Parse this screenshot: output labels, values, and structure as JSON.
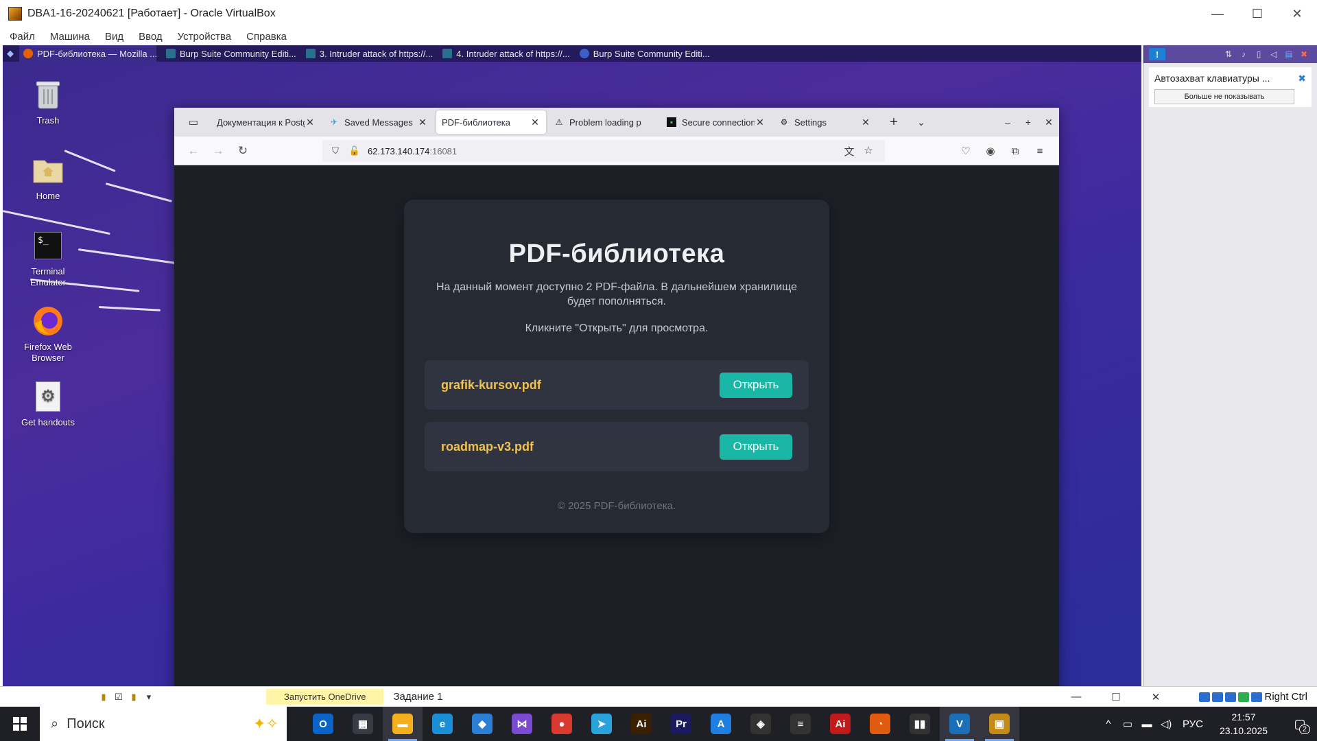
{
  "vbox": {
    "title": "DBA1-16-20240621 [Работает] - Oracle VirtualBox",
    "menu": [
      "Файл",
      "Машина",
      "Вид",
      "Ввод",
      "Устройства",
      "Справка"
    ],
    "minimize": "—",
    "maximize": "☐",
    "close": "✕"
  },
  "guest_taskbar": {
    "items": [
      {
        "label": "PDF-библиотека — Mozilla ...",
        "color": "#e66000"
      },
      {
        "label": "Burp Suite Community Editi...",
        "color": "#2a6f8e"
      },
      {
        "label": "3. Intruder attack of https://...",
        "color": "#2a6f8e"
      },
      {
        "label": "4. Intruder attack of https://...",
        "color": "#2a6f8e"
      },
      {
        "label": "Burp Suite Community Editi...",
        "color": "#3a5fc8"
      }
    ]
  },
  "desktop_icons": [
    {
      "label": "Trash",
      "icon": "trash-icon"
    },
    {
      "label": "Home",
      "icon": "home-folder-icon"
    },
    {
      "label": "Terminal Emulator",
      "icon": "terminal-icon",
      "glyph": "$_"
    },
    {
      "label": "Firefox Web Browser",
      "icon": "firefox-icon"
    },
    {
      "label": "Get handouts",
      "icon": "gear-icon",
      "glyph": "⚙"
    }
  ],
  "firefox": {
    "tabs": [
      {
        "label": "Документация к Postg",
        "icon": "",
        "active": false
      },
      {
        "label": "Saved Messages",
        "icon": "✈",
        "active": false
      },
      {
        "label": "PDF-библиотека",
        "icon": "",
        "active": true
      },
      {
        "label": "Problem loading p",
        "icon": "⚠",
        "active": false
      },
      {
        "label": "Secure connection",
        "icon": "▪",
        "active": false
      },
      {
        "label": "Settings",
        "icon": "⚙",
        "active": false
      }
    ],
    "tab_close": "✕",
    "new_tab": "+",
    "list_all_tabs": "⌄",
    "window_controls": [
      "–",
      "+",
      "✕"
    ],
    "url_host": "62.173.140.174",
    "url_port": ":16081"
  },
  "page": {
    "title": "PDF-библиотека",
    "description": "На данный момент доступно 2 PDF-файла. В дальнейшем хранилище будет пополняться.",
    "hint": "Кликните \"Открыть\" для просмотра.",
    "files": [
      {
        "name": "grafik-kursov.pdf",
        "button": "Открыть"
      },
      {
        "name": "roadmap-v3.pdf",
        "button": "Открыть"
      }
    ],
    "footer": "© 2025 PDF-библиотека."
  },
  "side_panel": {
    "badge": "!",
    "notice_title": "Автозахват клавиатуры ...",
    "notice_button": "Больше не показывать"
  },
  "vbox_status": {
    "onedrive": "Запустить OneDrive",
    "task": "Задание 1",
    "host_key": "Right Ctrl"
  },
  "win_taskbar": {
    "search_placeholder": "Поиск",
    "apps": [
      {
        "name": "outlook-icon",
        "glyph": "O",
        "color": "#0a64c8"
      },
      {
        "name": "store-icon",
        "glyph": "▦",
        "color": "#3a3a44"
      },
      {
        "name": "file-explorer-icon",
        "glyph": "▬",
        "color": "#f2b01e",
        "active": true
      },
      {
        "name": "edge-icon",
        "glyph": "e",
        "color": "#1b8fd6"
      },
      {
        "name": "paint-icon",
        "glyph": "◆",
        "color": "#2a7fd4"
      },
      {
        "name": "visual-studio-icon",
        "glyph": "⋈",
        "color": "#7a4bd1"
      },
      {
        "name": "chrome-icon",
        "glyph": "●",
        "color": "#d93a2f"
      },
      {
        "name": "telegram-icon",
        "glyph": "➤",
        "color": "#2aa3dd"
      },
      {
        "name": "illustrator-icon",
        "glyph": "Ai",
        "color": "#3a1f00"
      },
      {
        "name": "premiere-icon",
        "glyph": "Pr",
        "color": "#1a1a5e"
      },
      {
        "name": "app-store-icon",
        "glyph": "A",
        "color": "#1e7fe0"
      },
      {
        "name": "unity-icon",
        "glyph": "◈",
        "color": "#333"
      },
      {
        "name": "app-bars-icon",
        "glyph": "≡",
        "color": "#333"
      },
      {
        "name": "acrobat-icon",
        "glyph": "Ai",
        "color": "#c01a1a"
      },
      {
        "name": "power-icon",
        "glyph": "◔",
        "color": "#e05a10"
      },
      {
        "name": "twitch-icon",
        "glyph": "▮▮",
        "color": "#333"
      },
      {
        "name": "virtualbox-vm-icon",
        "glyph": "V",
        "color": "#1b6fb8",
        "active": true
      },
      {
        "name": "virtualbox-icon",
        "glyph": "▣",
        "color": "#c48a1a",
        "active": true
      }
    ],
    "language": "РУС",
    "time": "21:57",
    "date": "23.10.2025",
    "notifications": "2"
  }
}
